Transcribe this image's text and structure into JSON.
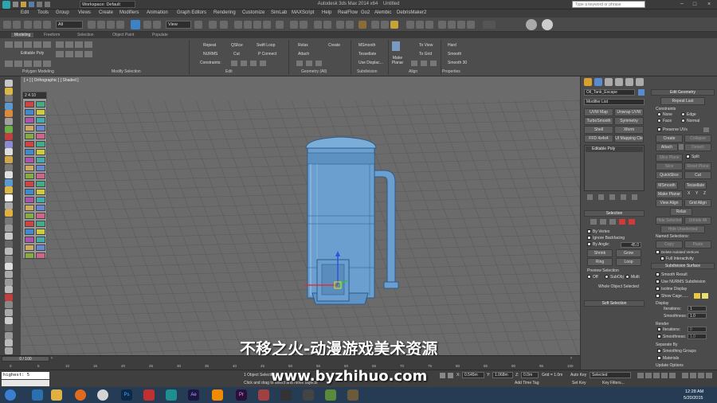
{
  "title": {
    "workspace": "Workspace: Default",
    "app": "Autodesk 3ds Max 2014 x64",
    "doc": "Untitled",
    "search_placeholder": "Type a keyword or phrase"
  },
  "menus": [
    "Edit",
    "Tools",
    "Group",
    "Views",
    "Create",
    "Modifiers",
    "Animation",
    "Graph Editors",
    "Rendering",
    "Customize",
    "SimLab",
    "MAXScript",
    "Help",
    "RealFlow",
    "Go2",
    "Alembic",
    "DebrisMaker2"
  ],
  "toolbar": {
    "selection_filter": "All",
    "view_dropdown": "View"
  },
  "ribbon": {
    "tabs": [
      "Modeling",
      "Freeform",
      "Selection",
      "Object Paint",
      "Populate"
    ],
    "panel_titles": [
      "Polygon Modeling",
      "Modify Selection",
      "Edit",
      "Geometry (All)",
      "Subdivision",
      "Align",
      "Properties"
    ],
    "editable_poly": "Editable Poly",
    "edit": [
      "Repeat",
      "QSlice",
      "Swift Loop",
      "NURMS",
      "Cut",
      "P Connect",
      "Constraints:"
    ],
    "geometry": [
      "Relax",
      "Create",
      "Attach"
    ],
    "subdivision": [
      "MSmooth",
      "Tessellate",
      "Use Displac..."
    ],
    "align": [
      "Make Planar",
      "To View",
      "To Grid"
    ],
    "properties": [
      "Hard",
      "Smooth",
      "Smooth 30"
    ]
  },
  "viewport": {
    "label": "[ + ] [ Orthographic ] [ Shaded ]"
  },
  "float_panel": {
    "header": "2 4 10"
  },
  "command_panel": {
    "object_name": "Oil_Tank_Escape",
    "modifier_list": "Modifier List",
    "mod_buttons": [
      "UVW Map",
      "Unwrap UVW",
      "TurboSmooth",
      "Symmetry",
      "Shell",
      "Xform",
      "FFD 4x4x4",
      "UI Mapping Cle"
    ],
    "stack_item": "Editable Poly",
    "selection": {
      "title": "Selection",
      "by_vertex": "By Vertex",
      "ignore_backfacing": "Ignore Backfacing",
      "by_angle": "By Angle:",
      "angle": "45.0",
      "shrink": "Shrink",
      "grow": "Grow",
      "ring": "Ring",
      "loop": "Loop",
      "preview_selection": "Preview Selection",
      "preview_opts": [
        "Off",
        "SubObj",
        "Multi"
      ],
      "whole_object": "Whole Object Selected"
    },
    "soft_selection": "Soft Selection",
    "edit_geometry": {
      "title": "Edit Geometry",
      "repeat_last": "Repeat Last",
      "constraints": "Constraints",
      "opts": [
        "None",
        "Edge",
        "Face",
        "Normal"
      ],
      "preserve_uvs": "Preserve UVs",
      "create": "Create",
      "collapse": "Collapse",
      "attach": "Attach",
      "detach": "Detach",
      "slice_plane": "Slice Plane",
      "split": "Split",
      "slice": "Slice",
      "reset_plane": "Reset Plane",
      "quickslice": "QuickSlice",
      "cut": "Cut",
      "msmooth": "MSmooth",
      "tessellate": "Tessellate",
      "make_planar": "Make Planar",
      "xyz": [
        "X",
        "Y",
        "Z"
      ],
      "view_align": "View Align",
      "grid_align": "Grid Align",
      "relax": "Relax",
      "hide_selected": "Hide Selected",
      "unhide_all": "Unhide All",
      "hide_unselected": "Hide Unselected",
      "named_selections": "Named Selections:",
      "copy": "Copy",
      "paste": "Paste",
      "delete_isolated": "Delete Isolated Vertices",
      "full_interactivity": "Full Interactivity"
    },
    "subdivision_surface": {
      "title": "Subdivision Surface",
      "smooth_result": "Smooth Result",
      "use_nurms": "Use NURMS Subdivision",
      "isoline": "Isoline Display",
      "show_cage": "Show Cage......",
      "display": "Display",
      "iterations_label": "Iterations:",
      "iterations": "1",
      "smoothness_label": "Smoothness:",
      "smoothness": "1.0",
      "render": "Render",
      "r_iterations": "0",
      "r_smoothness": "1.0",
      "separate_by": "Separate By",
      "smoothing_groups": "Smoothing Groups",
      "materials": "Materials",
      "update_options": "Update Options"
    }
  },
  "timeline": {
    "range": "0 / 100",
    "ticks": [
      "0",
      "5",
      "10",
      "15",
      "20",
      "25",
      "30",
      "35",
      "40",
      "45",
      "50",
      "55",
      "60",
      "65",
      "70",
      "75",
      "80",
      "85",
      "90",
      "95",
      "100"
    ]
  },
  "status": {
    "script": "highest: 5",
    "objects": "1 Object Selected",
    "hint": "Click and drag to select and move objects",
    "x_label": "X:",
    "x": "0.545m",
    "y_label": "Y:",
    "y": "1.068m",
    "z_label": "Z:",
    "z": "0.0m",
    "grid": "Grid = 1.0m",
    "add_time_tag": "Add Time Tag",
    "auto_key": "Auto Key",
    "set_key": "Set Key",
    "selected": "Selected",
    "key_filters": "Key Filters..."
  },
  "taskbar": {
    "time": "12:28 AM",
    "date": "5/20/2015"
  },
  "watermark": {
    "cn": "不移之火-动漫游戏美术资源",
    "url": "www.byzhihuo.com"
  },
  "colors": {
    "model": "#6a9fcf",
    "viewport": "#6b6b6b",
    "accent_yellow": "#e8c840",
    "selection_red": "#d23a3a"
  }
}
